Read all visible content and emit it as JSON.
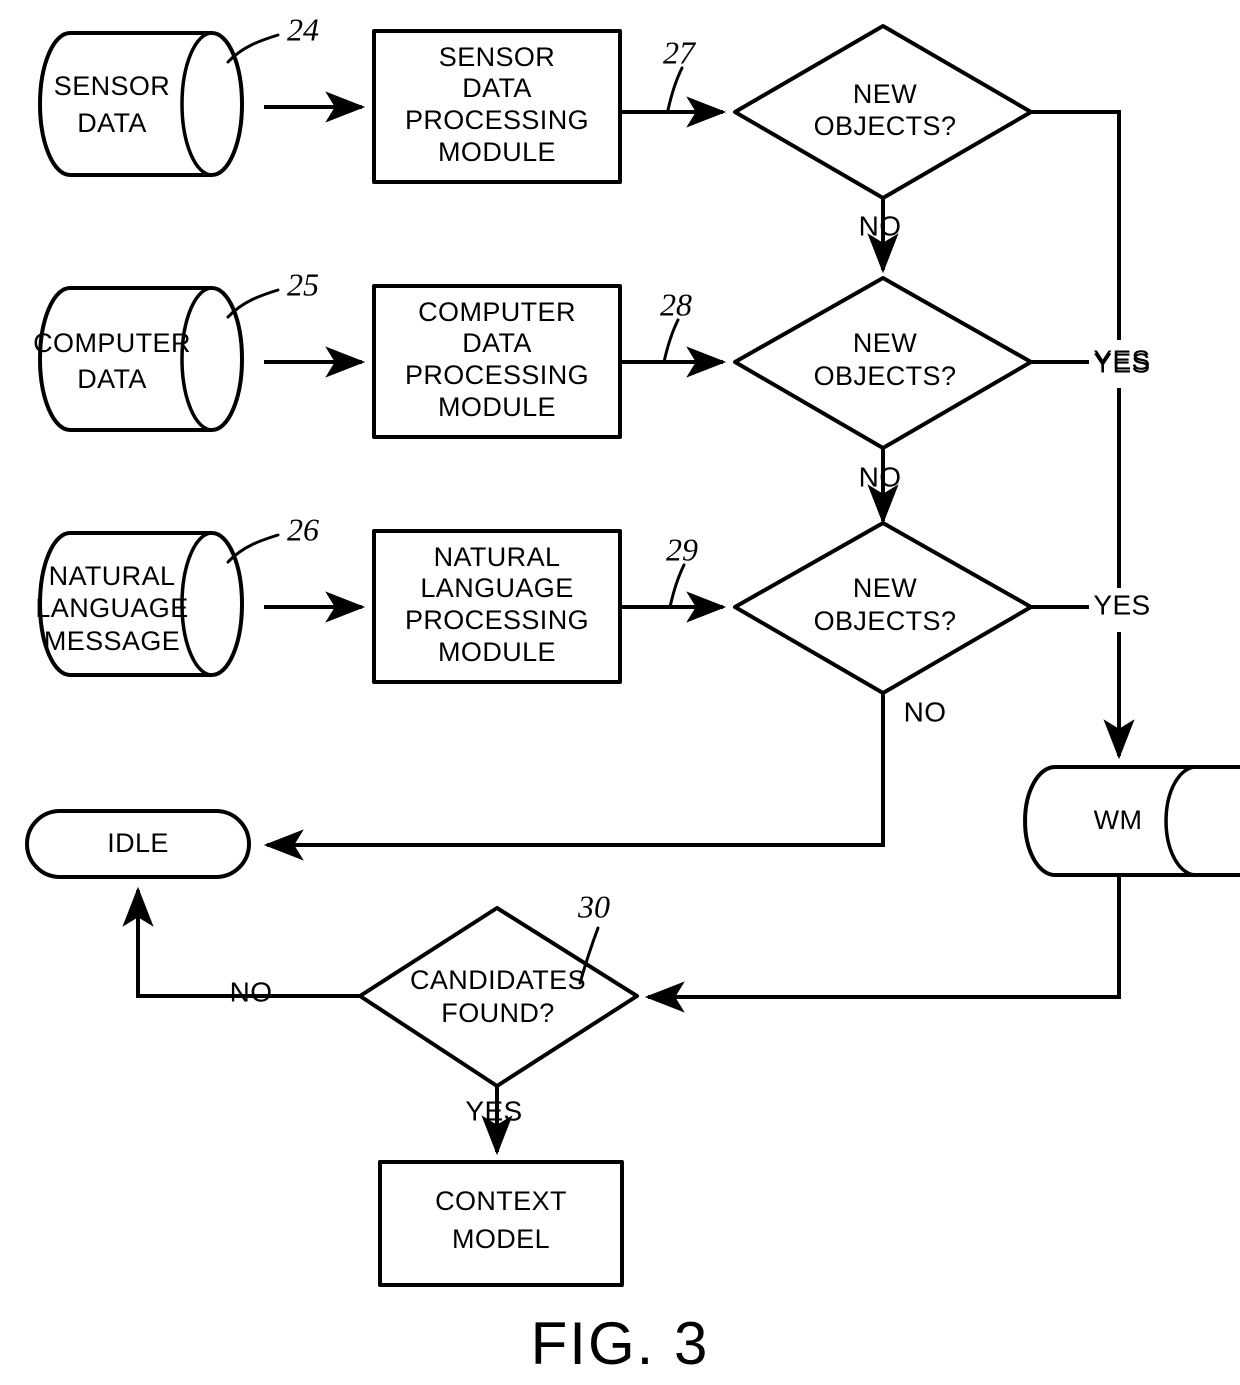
{
  "figure": {
    "caption": "FIG. 3",
    "type": "patent-flowchart"
  },
  "chart_data": {
    "type": "diagram",
    "title": "FIG. 3",
    "nodes": [
      {
        "id": "sensor-data",
        "label": "SENSOR\nDATA",
        "shape": "cylinder",
        "ref": "24"
      },
      {
        "id": "sensor-module",
        "label": "SENSOR\nDATA\nPROCESSING\nMODULE",
        "shape": "rect"
      },
      {
        "id": "decision-27",
        "label": "NEW\nOBJECTS?",
        "shape": "diamond",
        "ref": "27"
      },
      {
        "id": "computer-data",
        "label": "COMPUTER\nDATA",
        "shape": "cylinder",
        "ref": "25"
      },
      {
        "id": "computer-module",
        "label": "COMPUTER\nDATA\nPROCESSING\nMODULE",
        "shape": "rect"
      },
      {
        "id": "decision-28",
        "label": "NEW\nOBJECTS?",
        "shape": "diamond",
        "ref": "28"
      },
      {
        "id": "nl-message",
        "label": "NATURAL\nLANGUAGE\nMESSAGE",
        "shape": "cylinder",
        "ref": "26"
      },
      {
        "id": "nl-module",
        "label": "NATURAL\nLANGUAGE\nPROCESSING\nMODULE",
        "shape": "rect"
      },
      {
        "id": "decision-29",
        "label": "NEW\nOBJECTS?",
        "shape": "diamond",
        "ref": "29"
      },
      {
        "id": "wm",
        "label": "WM",
        "shape": "cylinder"
      },
      {
        "id": "idle",
        "label": "IDLE",
        "shape": "stadium"
      },
      {
        "id": "decision-30",
        "label": "CANDIDATES\nFOUND?",
        "shape": "diamond",
        "ref": "30"
      },
      {
        "id": "context-model",
        "label": "CONTEXT\nMODEL",
        "shape": "rect"
      }
    ],
    "edges": [
      {
        "from": "sensor-data",
        "to": "sensor-module",
        "label": ""
      },
      {
        "from": "sensor-module",
        "to": "decision-27",
        "label": ""
      },
      {
        "from": "decision-27",
        "to": "decision-28",
        "label": "NO"
      },
      {
        "from": "decision-27",
        "to": "wm",
        "label": "YES"
      },
      {
        "from": "computer-data",
        "to": "computer-module",
        "label": ""
      },
      {
        "from": "computer-module",
        "to": "decision-28",
        "label": ""
      },
      {
        "from": "decision-28",
        "to": "decision-29",
        "label": "NO"
      },
      {
        "from": "decision-28",
        "to": "wm",
        "label": "YES"
      },
      {
        "from": "nl-message",
        "to": "nl-module",
        "label": ""
      },
      {
        "from": "nl-module",
        "to": "decision-29",
        "label": ""
      },
      {
        "from": "decision-29",
        "to": "idle",
        "label": "NO"
      },
      {
        "from": "decision-29",
        "to": "wm",
        "label": "YES"
      },
      {
        "from": "wm",
        "to": "decision-30",
        "label": ""
      },
      {
        "from": "decision-30",
        "to": "idle",
        "label": "NO"
      },
      {
        "from": "decision-30",
        "to": "context-model",
        "label": "YES"
      }
    ]
  },
  "nodes": {
    "sensor_data": {
      "line1": "SENSOR",
      "line2": "DATA"
    },
    "sensor_module": {
      "line1": "SENSOR",
      "line2": "DATA",
      "line3": "PROCESSING",
      "line4": "MODULE"
    },
    "computer_data": {
      "line1": "COMPUTER",
      "line2": "DATA"
    },
    "computer_module": {
      "line1": "COMPUTER",
      "line2": "DATA",
      "line3": "PROCESSING",
      "line4": "MODULE"
    },
    "nl_message": {
      "line1": "NATURAL",
      "line2": "LANGUAGE",
      "line3": "MESSAGE"
    },
    "nl_module": {
      "line1": "NATURAL",
      "line2": "LANGUAGE",
      "line3": "PROCESSING",
      "line4": "MODULE"
    },
    "decision1": {
      "line1": "NEW",
      "line2": "OBJECTS?"
    },
    "decision2": {
      "line1": "NEW",
      "line2": "OBJECTS?"
    },
    "decision3": {
      "line1": "NEW",
      "line2": "OBJECTS?"
    },
    "decision4": {
      "line1": "CANDIDATES",
      "line2": "FOUND?"
    },
    "wm": {
      "label": "WM"
    },
    "idle": {
      "label": "IDLE"
    },
    "context_model": {
      "line1": "CONTEXT",
      "line2": "MODEL"
    }
  },
  "refs": {
    "sensor_data": "24",
    "computer_data": "25",
    "nl_message": "26",
    "decision1": "27",
    "decision2": "28",
    "decision3": "29",
    "decision4": "30"
  },
  "edge_labels": {
    "no1": "NO",
    "no2": "NO",
    "no3": "NO",
    "no4": "NO",
    "yes1": "YES",
    "yes2": "YES",
    "yes3": "YES",
    "yes4": "YES"
  },
  "caption": "FIG. 3",
  "colors": {
    "ink": "#000000",
    "paper": "#ffffff"
  }
}
